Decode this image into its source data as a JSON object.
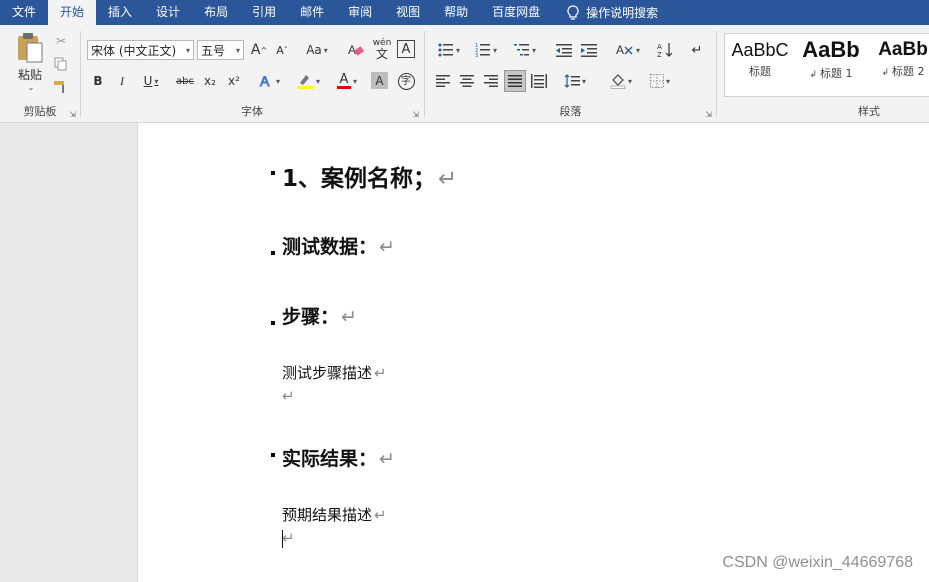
{
  "menu": {
    "tabs": [
      "文件",
      "开始",
      "插入",
      "设计",
      "布局",
      "引用",
      "邮件",
      "审阅",
      "视图",
      "帮助",
      "百度网盘"
    ],
    "active_tab": "开始",
    "search_label": "操作说明搜索"
  },
  "ribbon": {
    "clipboard": {
      "paste_label": "粘贴",
      "group_label": "剪贴板"
    },
    "font": {
      "font_name": "宋体 (中文正文)",
      "font_size": "五号",
      "grow": "A",
      "shrink": "A",
      "case": "Aa",
      "phonetic": "wén",
      "bold": "B",
      "italic": "I",
      "underline": "U",
      "strike": "abc",
      "subscript": "x₂",
      "superscript": "x²",
      "font_color": "A",
      "shade": "A",
      "enclose": "字",
      "group_label": "字体"
    },
    "paragraph": {
      "group_label": "段落"
    },
    "styles": {
      "items": [
        {
          "sample": "AaBbC",
          "name": "标题"
        },
        {
          "sample": "AaBb",
          "name": "标题 1"
        },
        {
          "sample": "AaBb",
          "name": "标题 2"
        }
      ],
      "group_label": "样式"
    }
  },
  "document": {
    "heading1": "1、案例名称；",
    "heading2a": "测试数据：",
    "heading2b": "步骤：",
    "text1": "测试步骤描述",
    "heading2c": "实际结果：",
    "text2": "预期结果描述",
    "para_mark": "↵"
  },
  "watermark": "CSDN @weixin_44669768",
  "colors": {
    "title_bar": "#2b579a",
    "ribbon": "#f3f3f3",
    "highlight": "#ffff00",
    "font_red": "#e00000"
  }
}
